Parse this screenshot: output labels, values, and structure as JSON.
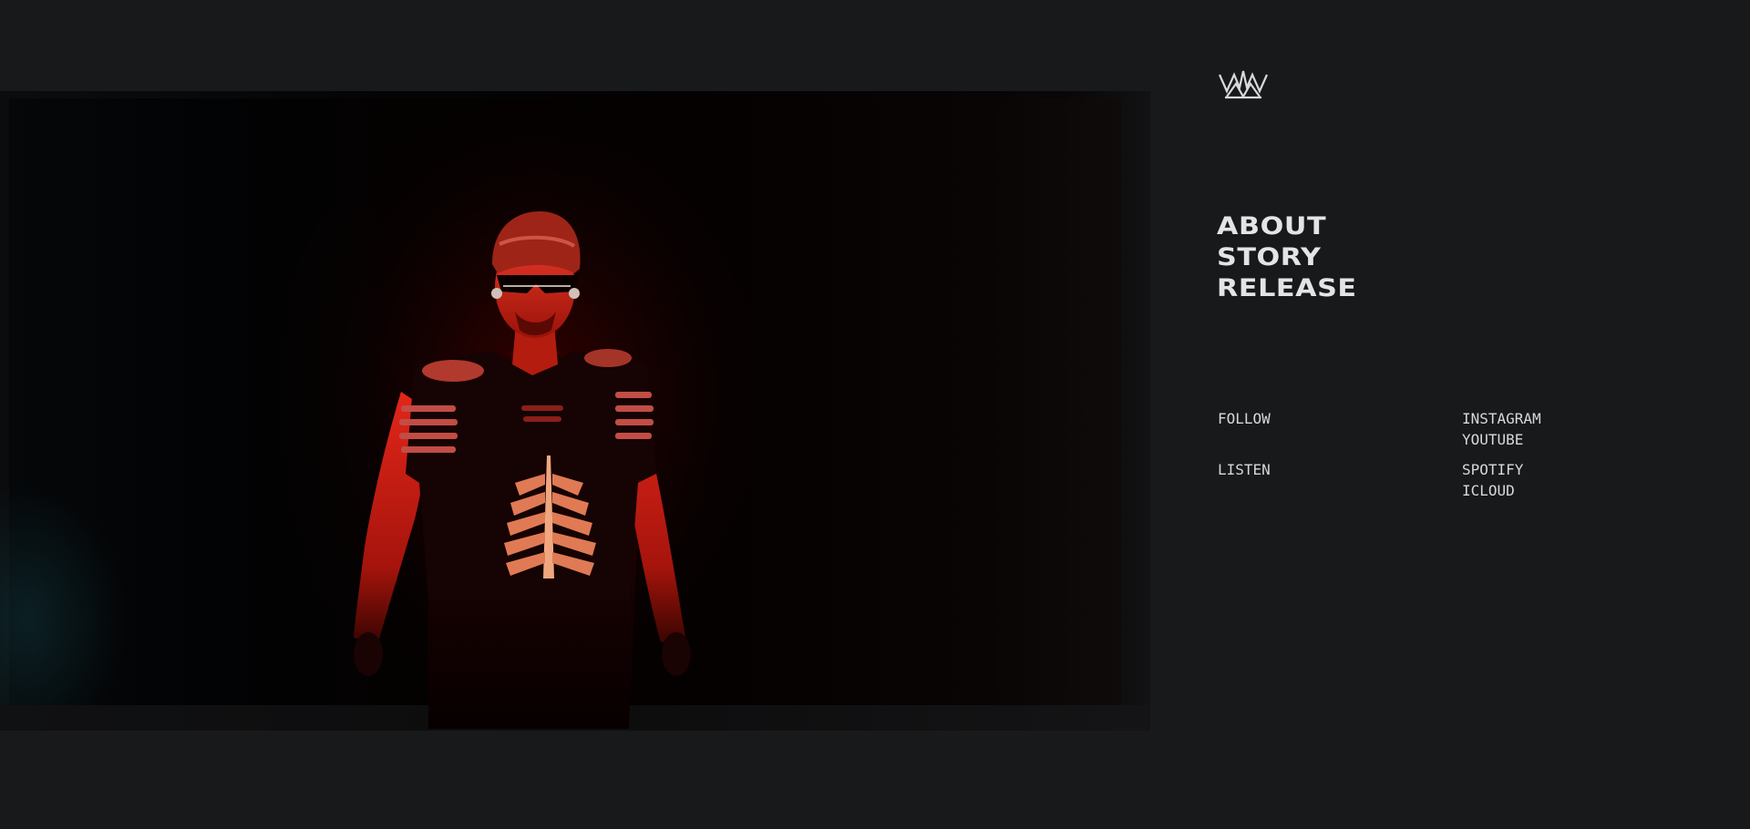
{
  "nav": {
    "items": [
      {
        "label": "ABOUT"
      },
      {
        "label": "STORY"
      },
      {
        "label": "RELEASE"
      }
    ]
  },
  "links": {
    "follow": {
      "label": "FOLLOW",
      "items": [
        "INSTAGRAM",
        "YOUTUBE"
      ]
    },
    "listen": {
      "label": "LISTEN",
      "items": [
        "SPOTIFY",
        "ICLOUD"
      ]
    }
  },
  "icons": {
    "logo": "crown-logo-icon"
  },
  "colors": {
    "background": "#18191b",
    "text": "#e4e4e4",
    "accent_red": "#d8281c"
  }
}
